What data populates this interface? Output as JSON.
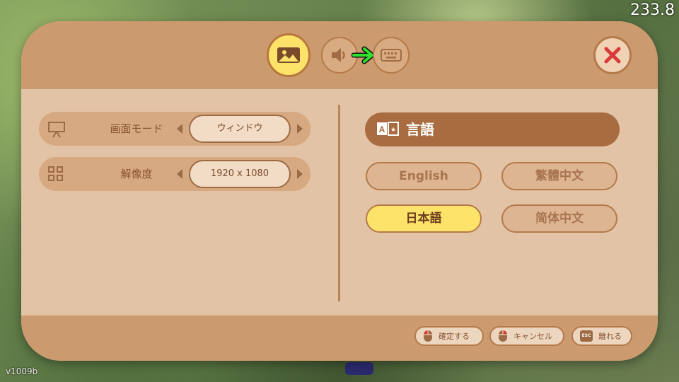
{
  "overlay": {
    "fps": "233.8",
    "version": "v1009b"
  },
  "tabs": [
    {
      "name": "graphics",
      "icon": "image-icon",
      "active": true
    },
    {
      "name": "sound",
      "icon": "speaker-icon",
      "active": false
    },
    {
      "name": "controls",
      "icon": "keyboard-icon",
      "active": false
    }
  ],
  "display_settings": [
    {
      "label": "画面モード",
      "value": "ウィンドウ",
      "icon": "presentation-icon"
    },
    {
      "label": "解像度",
      "value": "1920 x 1080",
      "icon": "grid-icon"
    }
  ],
  "language": {
    "title": "言語",
    "options": [
      {
        "label": "English",
        "selected": false
      },
      {
        "label": "繁體中文",
        "selected": false
      },
      {
        "label": "日本語",
        "selected": true
      },
      {
        "label": "简体中文",
        "selected": false
      }
    ]
  },
  "footer": {
    "confirm": "確定する",
    "cancel": "キャンセル",
    "leave": "離れる",
    "esc_key": "ESC"
  },
  "colors": {
    "panel": "#deb99a",
    "header": "#cb9a6e",
    "accent_yellow": "#fde36a",
    "language_header": "#a86c40",
    "close_x": "#d93a3a"
  }
}
